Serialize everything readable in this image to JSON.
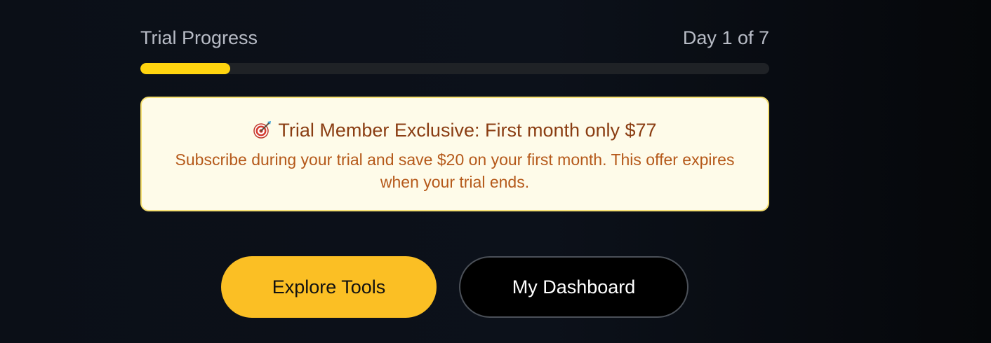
{
  "progress": {
    "label": "Trial Progress",
    "day_text": "Day 1 of 7",
    "fill_fraction": 0.143,
    "fill_color": "#ffd40f"
  },
  "offer": {
    "icon": "target-dart-icon",
    "title": "Trial Member Exclusive: First month only $77",
    "body": "Subscribe during your trial and save $20 on your first month. This offer expires when your trial ends."
  },
  "buttons": {
    "explore_label": "Explore Tools",
    "dashboard_label": "My Dashboard"
  },
  "colors": {
    "accent_yellow": "#fbbf24",
    "offer_bg": "#fefbe9",
    "offer_title": "#8a3d12",
    "offer_body": "#b5591a"
  }
}
